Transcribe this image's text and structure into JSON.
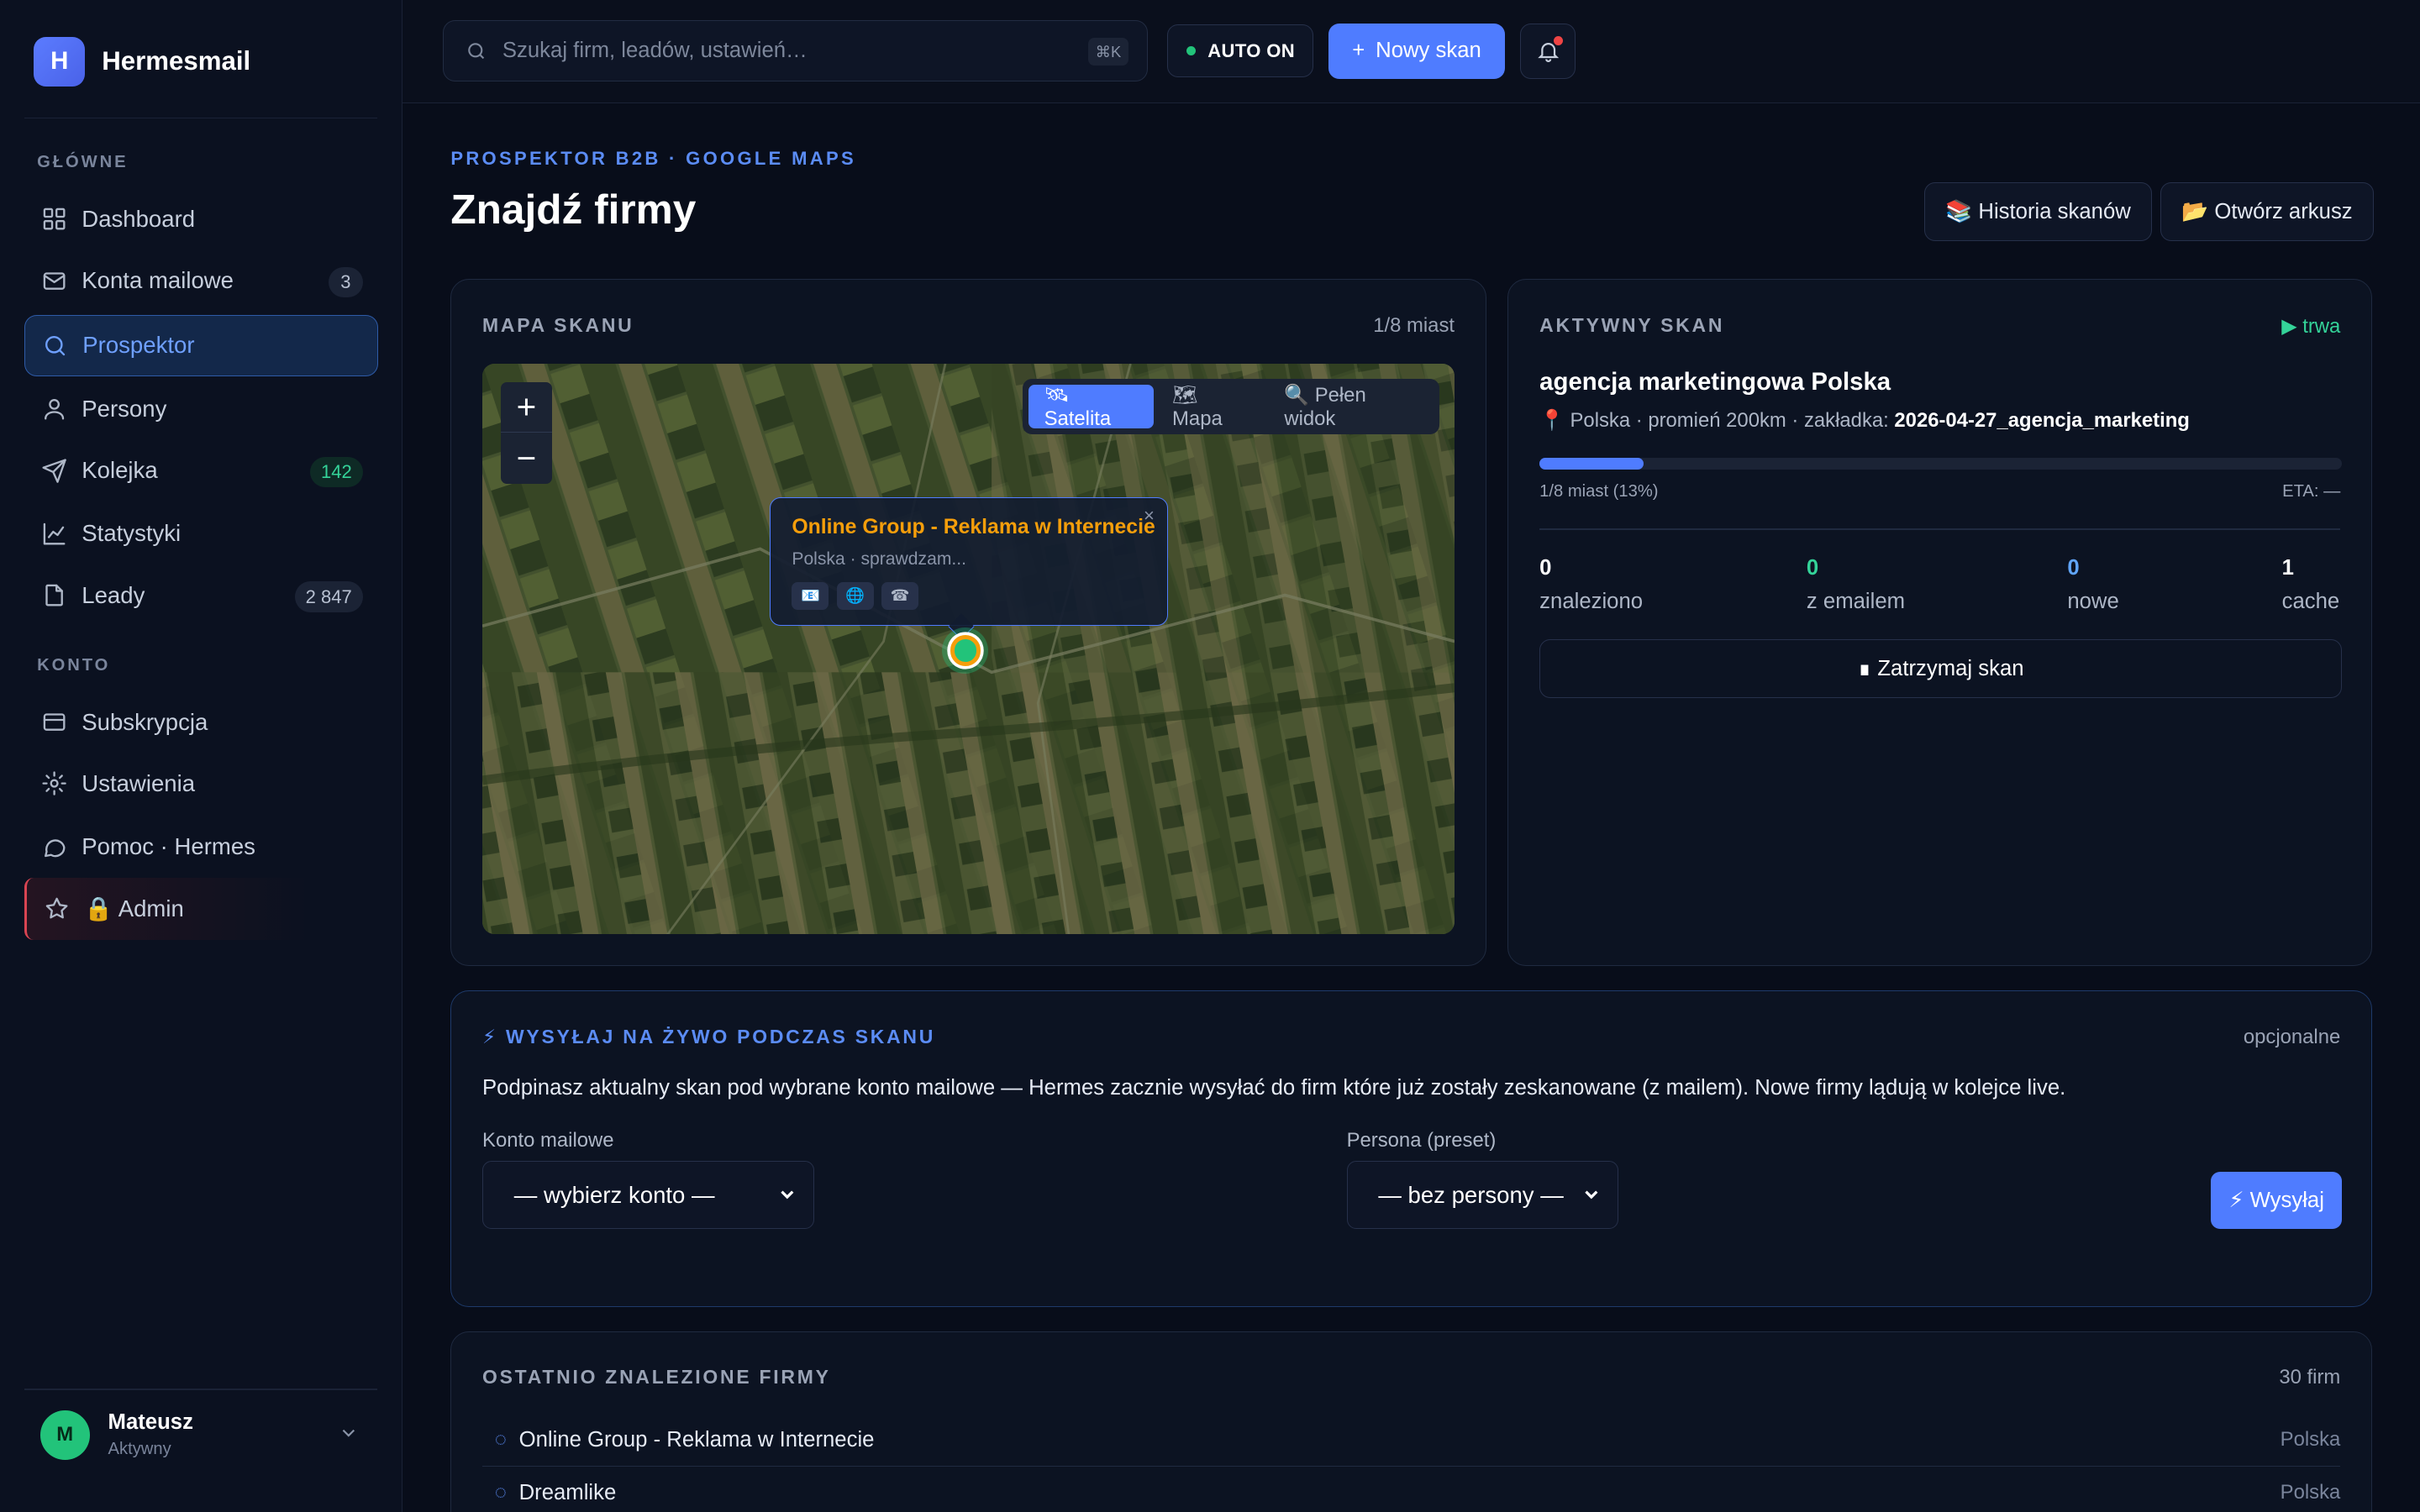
{
  "app": {
    "logo_letter": "H",
    "name": "Hermesmail"
  },
  "sidebar": {
    "section_main": "GŁÓWNE",
    "section_account": "KONTO",
    "items": [
      {
        "label": "Dashboard",
        "icon": "grid-icon"
      },
      {
        "label": "Konta mailowe",
        "icon": "mail-icon",
        "badge": "3"
      },
      {
        "label": "Prospektor",
        "icon": "search-icon",
        "active": true
      },
      {
        "label": "Persony",
        "icon": "user-icon"
      },
      {
        "label": "Kolejka",
        "icon": "send-icon",
        "badge": "142"
      },
      {
        "label": "Statystyki",
        "icon": "chart-icon"
      },
      {
        "label": "Leady",
        "icon": "file-icon",
        "badge": "2 847"
      },
      {
        "label": "Subskrypcja",
        "icon": "card-icon"
      },
      {
        "label": "Ustawienia",
        "icon": "gear-icon"
      },
      {
        "label": "Pomoc · Hermes",
        "icon": "chat-icon"
      },
      {
        "label": "🔒 Admin",
        "icon": "star-icon"
      }
    ],
    "user": {
      "initial": "M",
      "name": "Mateusz",
      "status": "Aktywny"
    }
  },
  "topbar": {
    "search_placeholder": "Szukaj firm, leadów, ustawień…",
    "search_shortcut": "⌘K",
    "auto_label": "AUTO ON",
    "new_scan_label": "Nowy skan"
  },
  "page": {
    "eyebrow": "PROSPEKTOR B2B · GOOGLE MAPS",
    "title": "Znajdź firmy",
    "history_button": "📚 Historia skanów",
    "sheet_button": "📂 Otwórz arkusz"
  },
  "map_card": {
    "title": "MAPA SKANU",
    "progress": "1/8 miast",
    "toggles": [
      "🛰 Satelita",
      "🗺 Mapa",
      "🔍 Pełen widok"
    ],
    "zoom_in": "+",
    "zoom_out": "−",
    "popup": {
      "name": "Online Group - Reklama w Internecie",
      "sub": "Polska · sprawdzam...",
      "icons": [
        "📧",
        "🌐",
        "☎"
      ],
      "close": "×"
    }
  },
  "scan_card": {
    "title": "AKTYWNY SKAN",
    "status": "▶ trwa",
    "query": "agencja marketingowa Polska",
    "meta_prefix": "📍 Polska · promień 200km · zakładka:",
    "sheet_name": "2026-04-27_agencja_marketing",
    "progress_fraction": 0.13,
    "progress_label": "1/8 miast (13%)",
    "eta": "ETA: —",
    "stats": [
      {
        "value": "0",
        "label": "znaleziono",
        "color": "#ffffff"
      },
      {
        "value": "0",
        "label": "z emailem",
        "color": "#34d399"
      },
      {
        "value": "0",
        "label": "nowe",
        "color": "#60a5fa"
      },
      {
        "value": "1",
        "label": "cache",
        "color": "#ffffff"
      }
    ],
    "stop_button": "∎ Zatrzymaj skan"
  },
  "live_card": {
    "title": "⚡ WYSYŁAJ NA ŻYWO PODCZAS SKANU",
    "optional": "opcjonalne",
    "description": "Podpinasz aktualny skan pod wybrane konto mailowe — Hermes zacznie wysyłać do firm które już zostały zeskanowane (z mailem). Nowe firmy lądują w kolejce live.",
    "account_label": "Konto mailowe",
    "account_value": "— wybierz konto —",
    "persona_label": "Persona (preset)",
    "persona_value": "— bez persony —",
    "send_button": "⚡ Wysyłaj"
  },
  "recent_card": {
    "title": "OSTATNIO ZNALEZIONE FIRMY",
    "count": "30 firm",
    "rows": [
      {
        "name": "Online Group - Reklama w Internecie",
        "country": "Polska"
      },
      {
        "name": "Dreamlike",
        "country": "Polska"
      }
    ]
  },
  "colors": {
    "accent": "#4f7cff",
    "bg": "#080d1a",
    "card": "#0c1322",
    "success": "#22c37a",
    "warning": "#f59e0b",
    "danger": "#ef4444"
  }
}
